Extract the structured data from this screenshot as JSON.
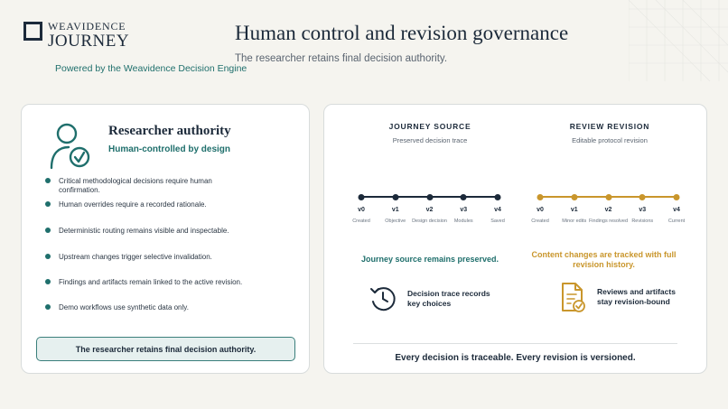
{
  "logo": {
    "line1": "WEAVIDENCE",
    "line2": "JOURNEY"
  },
  "powered_by": "Powered by the Weavidence Decision Engine",
  "title": "Human control and revision governance",
  "subtitle": "The researcher retains final decision authority.",
  "left_card": {
    "title": "Researcher authority",
    "subtitle": "Human-controlled by design",
    "bullets": [
      "Critical methodological decisions require human confirmation.",
      "Human overrides require a recorded rationale.",
      "Deterministic routing remains visible and inspectable.",
      "Upstream changes trigger selective invalidation.",
      "Findings and artifacts remain linked to the active revision.",
      "Demo workflows use synthetic data only."
    ],
    "callout": "The researcher retains final decision authority."
  },
  "right_card": {
    "source": {
      "heading": "JOURNEY SOURCE",
      "subheading": "Preserved decision trace",
      "color": "#1c2a3a",
      "versions": [
        "v0",
        "v1",
        "v2",
        "v3",
        "v4"
      ],
      "labels": [
        "Created",
        "Objective",
        "Design decision",
        "Modules",
        "Saved"
      ],
      "message": "Journey source remains preserved.",
      "feature": "Decision trace records key choices",
      "feature_icon": "clock-history-icon"
    },
    "revision": {
      "heading": "REVIEW REVISION",
      "subheading": "Editable protocol revision",
      "color": "#c9962c",
      "versions": [
        "v0",
        "v1",
        "v2",
        "v3",
        "v4"
      ],
      "labels": [
        "Created",
        "Minor edits",
        "Findings resolved",
        "Revisions",
        "Current"
      ],
      "message": "Content changes are tracked with full revision history.",
      "feature": "Reviews and artifacts stay revision-bound",
      "feature_icon": "document-check-icon"
    },
    "footer": "Every decision is traceable. Every revision is versioned."
  },
  "colors": {
    "teal": "#1f6f6c",
    "navy": "#1c2a3a",
    "gold": "#c9962c"
  }
}
